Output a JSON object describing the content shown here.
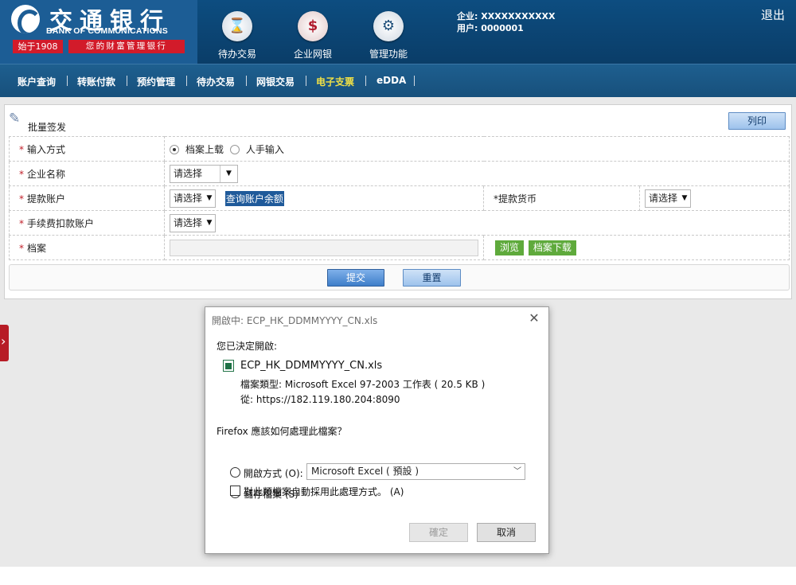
{
  "header": {
    "bank_name_cn": "交通银行",
    "bank_name_en": "BANK OF COMMUNICATIONS",
    "since": "始于1908",
    "slogan": "您的财富管理银行",
    "nav": [
      {
        "label": "待办交易",
        "icon": "hourglass-icon"
      },
      {
        "label": "企业网银",
        "icon": "monitor-dollar-icon"
      },
      {
        "label": "管理功能",
        "icon": "gears-icon"
      }
    ],
    "company_label": "企业: XXXXXXXXXXX",
    "user_label": "用户: 0000001",
    "logout": "退出"
  },
  "menu": {
    "items": [
      "账户查询",
      "转账付款",
      "预约管理",
      "待办交易",
      "网银交易",
      "电子支票",
      "eDDA"
    ],
    "active": "电子支票",
    "active_color": "#f0e046"
  },
  "panel": {
    "title": "批量签发",
    "print_button": "列印",
    "rows": {
      "input_method": {
        "label": "输入方式",
        "option_file": "档案上载",
        "option_manual": "人手输入",
        "selected": "档案上载"
      },
      "company": {
        "label": "企业名称",
        "value": "请选择"
      },
      "account": {
        "label": "提款账户",
        "value": "请选择",
        "link": "查询账户余额"
      },
      "currency": {
        "label": "提款货币",
        "value": "请选择"
      },
      "fee_account": {
        "label": "手续费扣款账户",
        "value": "请选择"
      },
      "file": {
        "label": "档案",
        "value": "",
        "browse": "浏览",
        "download": "档案下载"
      }
    },
    "submit": "提交",
    "reset": "重置"
  },
  "dialog": {
    "title": "開啟中: ECP_HK_DDMMYYYY_CN.xls",
    "intro": "您已決定開啟:",
    "filename": "ECP_HK_DDMMYYYY_CN.xls",
    "file_type": "檔案類型:  Microsoft Excel 97-2003 工作表 ( 20.5 KB )",
    "from": "從:  https://182.119.180.204:8090",
    "question": "Firefox 應該如何處理此檔案？",
    "open_with_label": "開啟方式 (O):",
    "open_with_value": "Microsoft Excel ( 預設 )",
    "save_label": "儲存檔案 (S)",
    "save_selected": true,
    "auto_label": "對此類檔案自動採用此處理方式。 (A)",
    "auto_checked": false,
    "ok": "確定",
    "cancel": "取消"
  }
}
